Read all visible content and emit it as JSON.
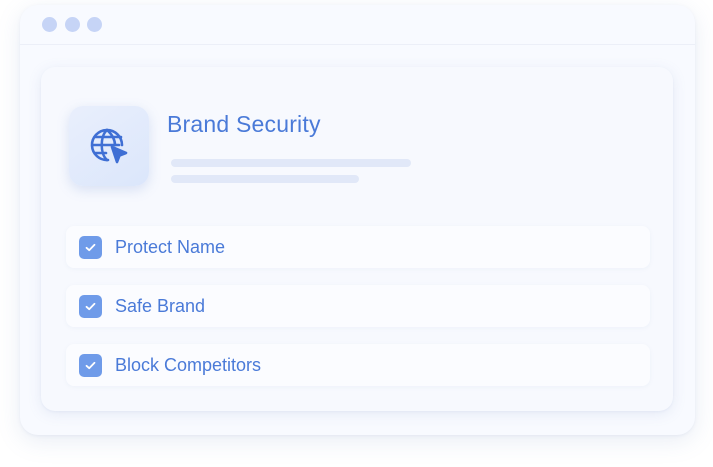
{
  "window": {
    "controls": [
      "dot",
      "dot",
      "dot"
    ]
  },
  "card": {
    "icon": "globe-cursor-icon",
    "title": "Brand Security",
    "options": [
      {
        "label": "Protect Name",
        "checked": true
      },
      {
        "label": "Safe Brand",
        "checked": true
      },
      {
        "label": "Block Competitors",
        "checked": true
      }
    ]
  },
  "colors": {
    "accent": "#4a7ad8",
    "checkbox": "#6f9be9",
    "window_dots": "#c6d4f6"
  }
}
